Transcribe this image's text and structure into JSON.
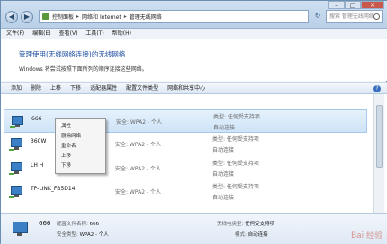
{
  "address": {
    "crumbs": [
      "控制面板",
      "网络和 Internet",
      "管理无线网络"
    ],
    "search_placeholder": "搜索 管理无线网络"
  },
  "menu": [
    "文件(F)",
    "编辑(E)",
    "查看(V)",
    "工具(T)",
    "帮助(H)"
  ],
  "header": {
    "title": "管理使用(无线网络连接)的无线网络",
    "subtitle": "Windows 将尝试按照下面所列的顺序连接这些网络。"
  },
  "toolbar": [
    "添加",
    "删除",
    "上移",
    "下移",
    "适配器属性",
    "配置文件类型",
    "网络和共享中心"
  ],
  "networks": [
    {
      "name": "666",
      "security": "安全: WPA2 - 个人",
      "type": "类型: 任何受支持项",
      "mode": "自动连接",
      "selected": true
    },
    {
      "name": "360W",
      "security": "安全: WPA2 - 个人",
      "type": "类型: 任何受支持项",
      "mode": "自动连接"
    },
    {
      "name": "LH H",
      "security": "安全: WPA2 - 个人",
      "type": "类型: 任何受支持项",
      "mode": "自动连接"
    },
    {
      "name": "TP-LINK_FB5D14",
      "security": "安全: WPA2 - 个人",
      "type": "类型: 任何受支持项",
      "mode": "自动连接"
    }
  ],
  "context_menu": [
    "属性",
    "删除网络",
    "重命名",
    "上移",
    "下移"
  ],
  "details": {
    "name": "666",
    "profile_label": "配置文件名称:",
    "profile_value": "666",
    "security_label": "安全类型:",
    "security_value": "WPA2 - 个人",
    "radio_label": "无线电类型:",
    "radio_value": "任何受支持项",
    "mode_label": "模式:",
    "mode_value": "自动连接"
  },
  "watermark": "Bai 经验"
}
